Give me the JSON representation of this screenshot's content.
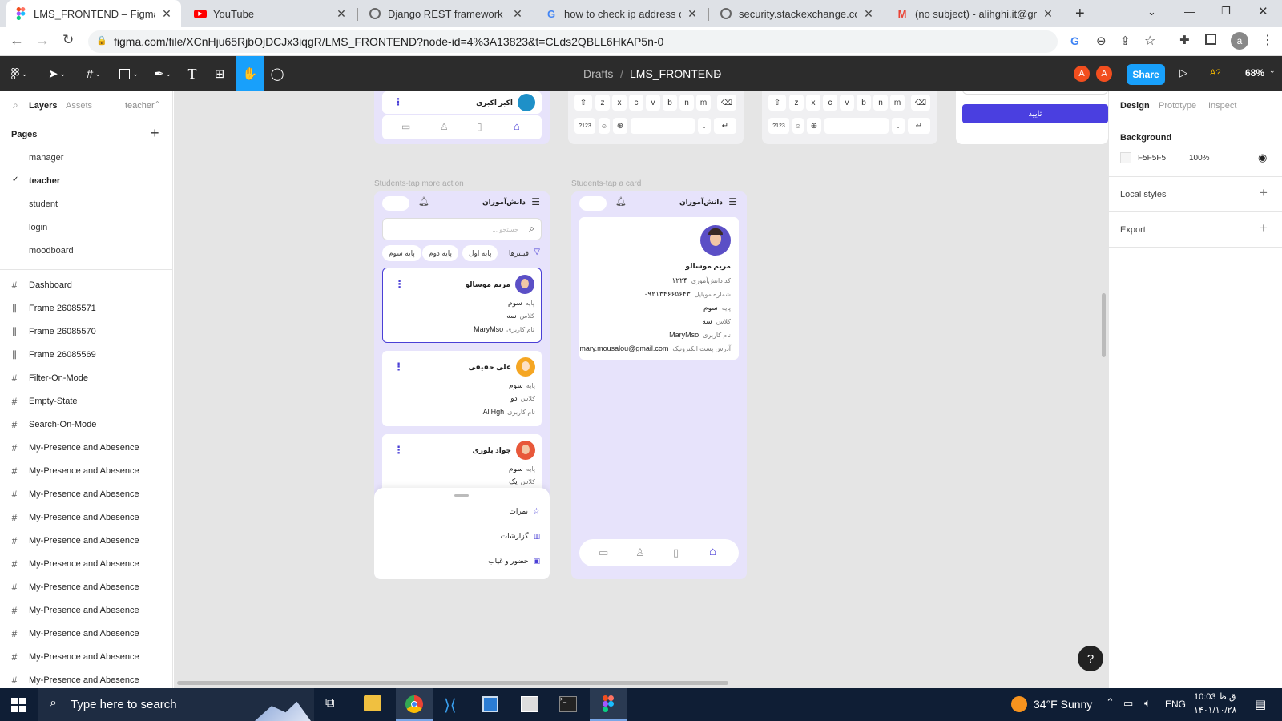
{
  "browser": {
    "tabs": [
      {
        "title": "LMS_FRONTEND – Figma",
        "icon": "figma-icon",
        "active": true
      },
      {
        "title": "YouTube",
        "icon": "youtube-icon",
        "active": false
      },
      {
        "title": "Django REST framework",
        "icon": "globe-icon",
        "active": false
      },
      {
        "title": "how to check ip address of w",
        "icon": "google-icon",
        "active": false
      },
      {
        "title": "security.stackexchange.com",
        "icon": "globe-icon",
        "active": false
      },
      {
        "title": "(no subject) - alihghi.it@gmai",
        "icon": "gmail-icon",
        "active": false
      }
    ],
    "url": "figma.com/file/XCnHju65RjbOjDCJx3iqgR/LMS_FRONTEND?node-id=4%3A13823&t=CLds2QBLL6HkAP5n-0",
    "profile_initial": "a"
  },
  "figma": {
    "breadcrumb": {
      "drafts": "Drafts",
      "separator": "/",
      "file": "LMS_FRONTEND"
    },
    "avatars": [
      "A",
      "A"
    ],
    "share_label": "Share",
    "font_hint": "A?",
    "zoom": "68%",
    "accent": "#18a0fb",
    "left_panel": {
      "tabs": {
        "layers": "Layers",
        "assets": "Assets",
        "page": "teacher"
      },
      "pages_title": "Pages",
      "pages": [
        "manager",
        "teacher",
        "student",
        "login",
        "moodboard"
      ],
      "current_page": "teacher",
      "layers": [
        "Dashboard",
        "Frame 26085571",
        "Frame 26085570",
        "Frame 26085569",
        "Filter-On-Mode",
        "Empty-State",
        "Search-On-Mode",
        "My-Presence and Abesence",
        "My-Presence and Abesence",
        "My-Presence and Abesence",
        "My-Presence and Abesence",
        "My-Presence and Abesence",
        "My-Presence and Abesence",
        "My-Presence and Abesence",
        "My-Presence and Abesence",
        "My-Presence and Abesence",
        "My-Presence and Abesence",
        "My-Presence and Abesence"
      ]
    },
    "right_panel": {
      "tabs": [
        "Design",
        "Prototype",
        "Inspect"
      ],
      "background_title": "Background",
      "bg_hex": "F5F5F5",
      "bg_opacity": "100%",
      "local_styles": "Local styles",
      "export": "Export"
    },
    "canvas": {
      "top_card_name": "اکبر اکبری",
      "keyboard_row": [
        "z",
        "x",
        "c",
        "v",
        "b",
        "n",
        "m"
      ],
      "kb_num": "?123",
      "kb_dot": ".",
      "confirm_label": "تایید",
      "frame1": {
        "label": "Students-tap more action",
        "title": "دانش‌آموزان",
        "search_placeholder": "جستجو ...",
        "filters": "فیلترها",
        "chips": [
          "پایه اول",
          "پایه دوم",
          "پایه سوم"
        ],
        "students": [
          {
            "name": "مریم موسالو",
            "grade_label": "پایه",
            "grade": "سوم",
            "class_label": "کلاس",
            "class": "سه",
            "user_label": "نام کاربری",
            "user": "MaryMso"
          },
          {
            "name": "علی حقیقی",
            "grade_label": "پایه",
            "grade": "سوم",
            "class_label": "کلاس",
            "class": "دو",
            "user_label": "نام کاربری",
            "user": "AliHgh"
          },
          {
            "name": "جواد بلوری",
            "grade_label": "پایه",
            "grade": "سوم",
            "class_label": "کلاس",
            "class": "یک"
          }
        ],
        "sheet": [
          "نمرات",
          "گزارشات",
          "حضور و غیاب"
        ]
      },
      "frame2": {
        "label": "Students-tap a card",
        "title": "دانش‌آموزان",
        "name": "مریم موسالو",
        "rows": [
          {
            "label": "کد دانش‌آموزی",
            "value": "۱۲۲۴"
          },
          {
            "label": "شماره موبایل",
            "value": "۰۹۲۱۳۴۶۶۵۶۴۳"
          },
          {
            "label": "پایه",
            "value": "سوم"
          },
          {
            "label": "کلاس",
            "value": "سه"
          },
          {
            "label": "نام کاربری",
            "value": "MaryMso"
          },
          {
            "label": "آدرس پست الکترونیک",
            "value": "mary.mousalou@gmail.com"
          }
        ]
      }
    }
  },
  "taskbar": {
    "search_placeholder": "Type here to search",
    "weather": "34°F  Sunny",
    "lang": "ENG",
    "time": "10:03 ق.ظ",
    "date": "۱۴۰۱/۱۰/۲۸"
  }
}
